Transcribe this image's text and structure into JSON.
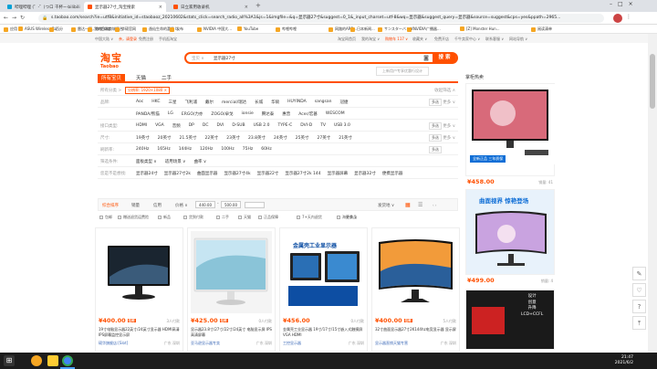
{
  "browser": {
    "tabs": [
      {
        "label": "哔哩哔哩 (゜-゜)つロ 干杯~-bilibili"
      },
      {
        "label": "显示器27寸_淘宝搜索"
      },
      {
        "label": "日立家用收录机"
      }
    ],
    "url": "s.taobao.com/search?ie=utf8&initiative_id=staobaoz_20210602&stats_click=search_radio_all%3A1&js=1&imgfile=&q=显示器27寸&suggest=0_1&_input_charset=utf-8&wq=显示器&suggest_query=显示器&source=suggest&cps=yes&ppath=2965...",
    "bookmarks": [
      "应用",
      "ASUS Wireless Ro...",
      "百分",
      "雷达一下，你就知道",
      "我的日本商城平台",
      "华硕官网",
      "逸仙生命的喜乐 I...",
      "发布",
      "NVIDIA 中国大...",
      "YouTube",
      "哔哩哔哩",
      "网路的ARB...",
      "日本新闻...",
      "サンスターバンダ...",
      "NVIDIA广播器...",
      "[Z] Monster Hun...",
      "阅读清单"
    ]
  },
  "topnav": {
    "left": [
      "中国大陆 ∨",
      "亲，请登录",
      "免费注册",
      "手机逛淘宝"
    ],
    "right": [
      "淘宝网首页",
      "我的淘宝 ∨",
      "购物车 117 ∨",
      "收藏夹 ∨",
      "免费开店",
      "千牛卖家中心 ∨",
      "联系客服 ∨",
      "网站导航 ∨"
    ]
  },
  "logo": {
    "main": "淘宝",
    "sub": "Taobao"
  },
  "search": {
    "category": "宝贝 ∨",
    "query": "显示器27寸",
    "button": "搜 索",
    "hint": "上新用户专享优惠行设计"
  },
  "cattabs": [
    "所有宝贝",
    "天猫",
    "二手"
  ],
  "breadcrumb": {
    "prefix": "所有分类 >",
    "chip": "分辨率: 1920×1080 ×",
    "collapse": "收起筛选 ∧"
  },
  "filters": [
    {
      "label": "品牌:",
      "options": [
        "Aoc",
        "HKC",
        "三星",
        "飞利浦",
        "戴尔",
        "mercial/瑞达",
        "长城",
        "华硕",
        "HUYINDA",
        "sangsan",
        "冠捷"
      ],
      "multi": "多选",
      "more": "更多 ∨"
    },
    {
      "label": "",
      "options": [
        "PANDA/熊猫",
        "LG",
        "ERGO/力亦",
        "ZOGO/卓戈",
        "ionsie",
        "腾达泰",
        "惠普",
        "Acer/宏碁",
        "WESCOM"
      ],
      "multi": "",
      "more": ""
    },
    {
      "label": "接口类型:",
      "options": [
        "HDMI",
        "VGA",
        "音频",
        "DP",
        "DC",
        "DVI",
        "D-SUB",
        "USB 2.0",
        "TYPE-C",
        "DVI-D",
        "TV",
        "USB 3.0"
      ],
      "multi": "多选",
      "more": "更多 ∨"
    },
    {
      "label": "尺寸:",
      "options": [
        "19英寸",
        "20英寸",
        "21.5英寸",
        "22英寸",
        "23英寸",
        "23.8英寸",
        "24英寸",
        "25英寸",
        "27英寸",
        "21英寸"
      ],
      "multi": "多选",
      "more": "更多 ∨"
    },
    {
      "label": "刷新率:",
      "options": [
        "240Hz",
        "165Hz",
        "144Hz",
        "120Hz",
        "100Hz",
        "75Hz",
        "60Hz"
      ],
      "multi": "多选",
      "more": ""
    },
    {
      "label": "筛选条件:",
      "options": [
        "面板类型 ∨",
        "适用场景 ∨",
        "曲率 ∨"
      ],
      "multi": "",
      "more": ""
    },
    {
      "label": "您是不是想找:",
      "options": [
        "显示器24寸",
        "显示器27寸2k",
        "曲面显示器",
        "显示器27寸4k",
        "显示器22寸",
        "显示器27寸2k 144",
        "显示器屏幕",
        "显示器32寸",
        "便携显示器"
      ],
      "multi": "",
      "more": ""
    }
  ],
  "sortbar": {
    "items": [
      "综合排序",
      "销量",
      "信用",
      "价格 ∨"
    ],
    "price_from": "440.00",
    "price_to": "500.00",
    "location": "发货地 ∨"
  },
  "checks": [
    "包邮",
    "赠送退货运费险",
    "新品",
    "货到付款",
    "二手",
    "天猫",
    "正品保障",
    "7+天内退货",
    "海外商品"
  ],
  "checks_more": "更多 ∨",
  "products": [
    {
      "price": "400.00",
      "deal": "3人付款",
      "title": "19寸电脑显示器22英寸/24英寸显示器 HDMI高清IPS屏幕监控显示屏",
      "shop": "硕华旗舰店:[Slot]",
      "loc": "广东 深圳"
    },
    {
      "price": "425.00",
      "deal": "0人付款",
      "title": "显示器23.8寸/27寸/22寸/24英寸 电脑显示屏 IPS高清屏幕",
      "shop": "亚马逊显示器专卖",
      "loc": "广东 深圳"
    },
    {
      "price": "456.00",
      "deal": "0人付款",
      "title": "金属壳工业显示器 19寸/17寸/15寸嵌入式触摸屏 VGA HDMI",
      "shop": "工控显示器",
      "loc": "广东 深圳"
    },
    {
      "price": "400.00",
      "deal": "5人付款",
      "title": "32寸曲面显示器27寸2K144hz电竞显示器 显示屏",
      "shop": "显示器直销天猫专营",
      "loc": "广东 深圳"
    }
  ],
  "product_banner": "金属壳工业显示器",
  "rail": {
    "title": "掌柜热卖",
    "items": [
      {
        "price": "458.00",
        "sales": "销量: 41",
        "badge": "全新正品  三年质保"
      },
      {
        "price": "499.00",
        "sales": "销量: 4",
        "banner": "曲面视界 惊艳登场"
      },
      {
        "price": "",
        "sales": "",
        "lines": [
          "设计",
          "创意",
          "升降",
          "LCD+CCFL"
        ]
      }
    ]
  },
  "sidetools": [
    "✎",
    "♡",
    "?",
    "⤒"
  ],
  "clock": {
    "time": "21:47",
    "date": "2021/6/2"
  }
}
